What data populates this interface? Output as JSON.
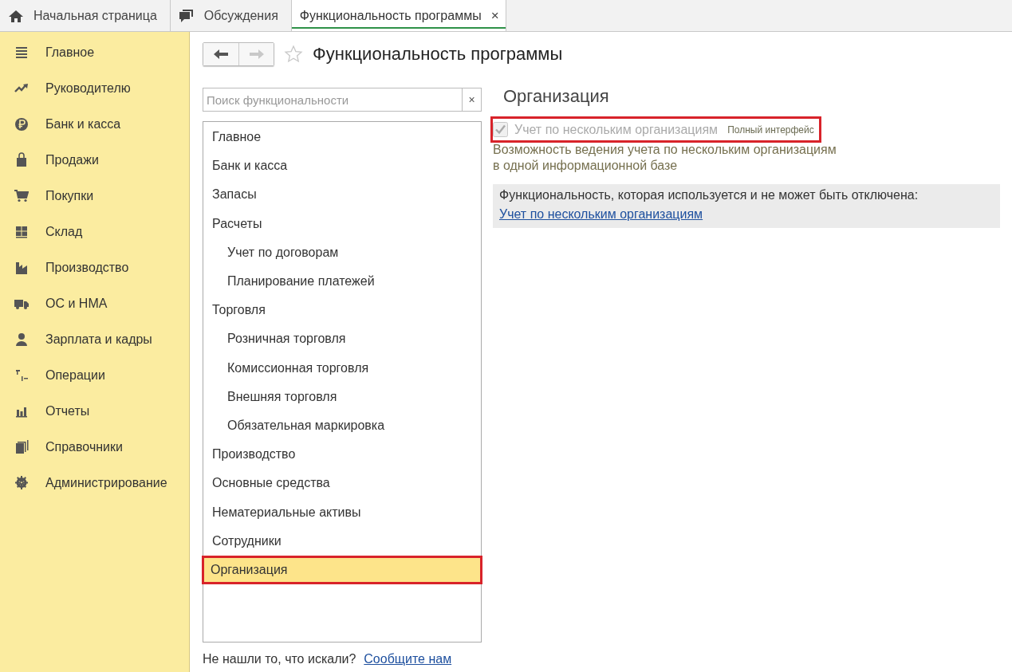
{
  "tabs": [
    {
      "label": "Начальная страница",
      "kind": "home",
      "selected": false
    },
    {
      "label": "Обсуждения",
      "kind": "chat",
      "selected": false
    },
    {
      "label": "Функциональность программы",
      "kind": "plain",
      "selected": true,
      "close": "×"
    }
  ],
  "sidebar": {
    "items": [
      {
        "label": "Главное"
      },
      {
        "label": "Руководителю"
      },
      {
        "label": "Банк и касса"
      },
      {
        "label": "Продажи"
      },
      {
        "label": "Покупки"
      },
      {
        "label": "Склад"
      },
      {
        "label": "Производство"
      },
      {
        "label": "ОС и НМА"
      },
      {
        "label": "Зарплата и кадры"
      },
      {
        "label": "Операции"
      },
      {
        "label": "Отчеты"
      },
      {
        "label": "Справочники"
      },
      {
        "label": "Администрирование"
      }
    ]
  },
  "page": {
    "title": "Функциональность программы",
    "favorite": false,
    "back_disabled": false,
    "forward_disabled": true
  },
  "search": {
    "placeholder": "Поиск функциональности",
    "clear": "×"
  },
  "sections": [
    {
      "label": "Главное",
      "selected": false,
      "highlighted": false
    },
    {
      "label": "Банк и касса",
      "selected": false,
      "highlighted": false
    },
    {
      "label": "Запасы",
      "selected": false,
      "highlighted": false
    },
    {
      "label": "Расчеты",
      "selected": false,
      "highlighted": false,
      "children": [
        {
          "label": "Учет по договорам",
          "selected": false,
          "highlighted": false
        },
        {
          "label": "Планирование платежей",
          "selected": false,
          "highlighted": false
        }
      ]
    },
    {
      "label": "Торговля",
      "selected": false,
      "highlighted": false,
      "children": [
        {
          "label": "Розничная торговля",
          "selected": false,
          "highlighted": false
        },
        {
          "label": "Комиссионная торговля",
          "selected": false,
          "highlighted": false
        },
        {
          "label": "Внешняя торговля",
          "selected": false,
          "highlighted": false
        },
        {
          "label": "Обязательная маркировка",
          "selected": false,
          "highlighted": false
        }
      ]
    },
    {
      "label": "Производство",
      "selected": false,
      "highlighted": false
    },
    {
      "label": "Основные средства",
      "selected": false,
      "highlighted": false
    },
    {
      "label": "Нематериальные активы",
      "selected": false,
      "highlighted": false
    },
    {
      "label": "Сотрудники",
      "selected": false,
      "highlighted": false
    },
    {
      "label": "Организация",
      "selected": true,
      "highlighted": true
    }
  ],
  "footer": {
    "text": "Не нашли то, что искали?",
    "link": "Сообщите нам"
  },
  "detail": {
    "heading": "Организация",
    "option": {
      "label": "Учет по нескольким организациям",
      "checked": true,
      "disabled": true,
      "badge": "Полный интерфейс",
      "highlighted": true
    },
    "description": "Возможность ведения учета по нескольким организациям в одной информационной базе",
    "notice": {
      "text": "Функциональность, которая используется и не может быть отключена:",
      "link": "Учет по нескольким организациям"
    }
  }
}
